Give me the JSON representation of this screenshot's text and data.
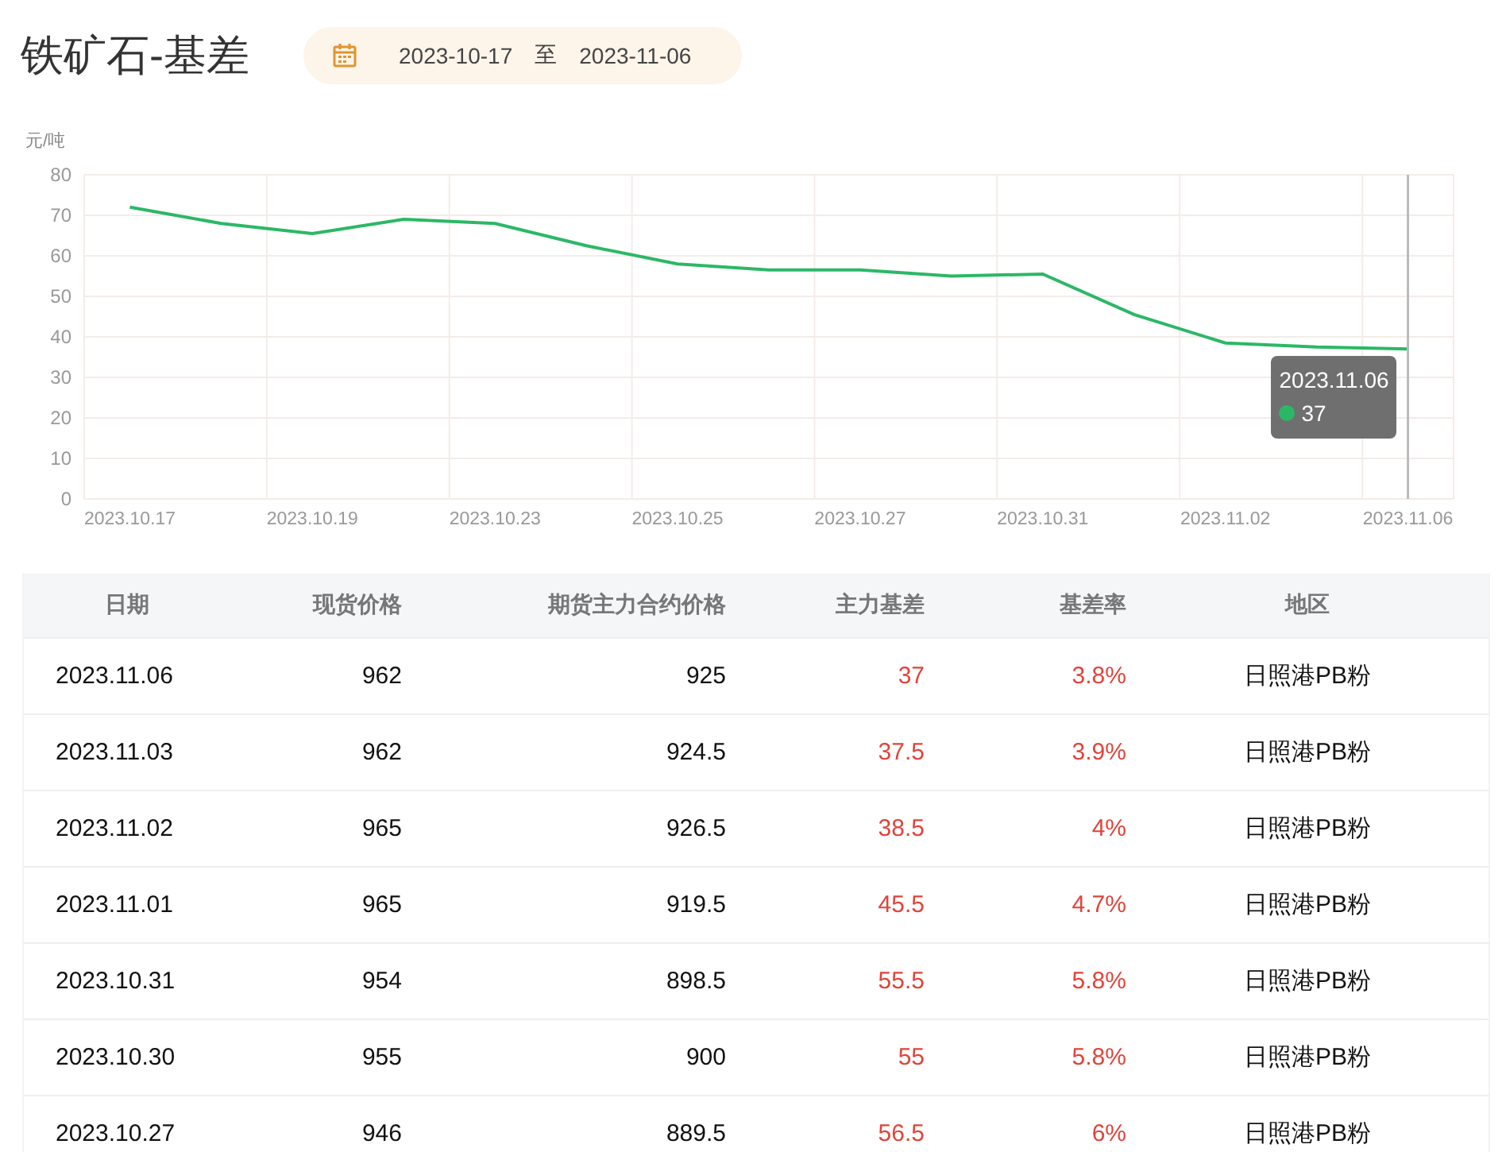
{
  "title": "铁矿石-基差",
  "date_range": {
    "start": "2023-10-17",
    "separator": "至",
    "end": "2023-11-06"
  },
  "chart_data": {
    "type": "line",
    "ylabel": "元/吨",
    "categories": [
      "2023.10.17",
      null,
      "2023.10.19",
      null,
      "2023.10.23",
      null,
      "2023.10.25",
      null,
      "2023.10.27",
      null,
      "2023.10.31",
      null,
      "2023.11.02",
      null,
      "2023.11.06"
    ],
    "series": [
      {
        "color": "#2bb866",
        "values": [
          72,
          68,
          65.5,
          69,
          68,
          62.5,
          58,
          56.5,
          56.5,
          55,
          55.5,
          45.5,
          38.5,
          37.5,
          37
        ]
      }
    ],
    "ylim": [
      0,
      80
    ],
    "yticks": [
      0,
      10,
      20,
      30,
      40,
      50,
      60,
      70,
      80
    ],
    "grid": true,
    "ref_lines": [
      {
        "axis": "x",
        "value": "2023.11.06",
        "color": "#bbbbbb"
      }
    ]
  },
  "tooltip": {
    "date": "2023.11.06",
    "value": "37"
  },
  "table": {
    "columns": [
      "日期",
      "现货价格",
      "期货主力合约价格",
      "主力基差",
      "基差率",
      "地区"
    ],
    "rows": [
      [
        "2023.11.06",
        "962",
        "925",
        "37",
        "3.8%",
        "日照港PB粉"
      ],
      [
        "2023.11.03",
        "962",
        "924.5",
        "37.5",
        "3.9%",
        "日照港PB粉"
      ],
      [
        "2023.11.02",
        "965",
        "926.5",
        "38.5",
        "4%",
        "日照港PB粉"
      ],
      [
        "2023.11.01",
        "965",
        "919.5",
        "45.5",
        "4.7%",
        "日照港PB粉"
      ],
      [
        "2023.10.31",
        "954",
        "898.5",
        "55.5",
        "5.8%",
        "日照港PB粉"
      ],
      [
        "2023.10.30",
        "955",
        "900",
        "55",
        "5.8%",
        "日照港PB粉"
      ],
      [
        "2023.10.27",
        "946",
        "889.5",
        "56.5",
        "6%",
        "日照港PB粉"
      ]
    ]
  }
}
